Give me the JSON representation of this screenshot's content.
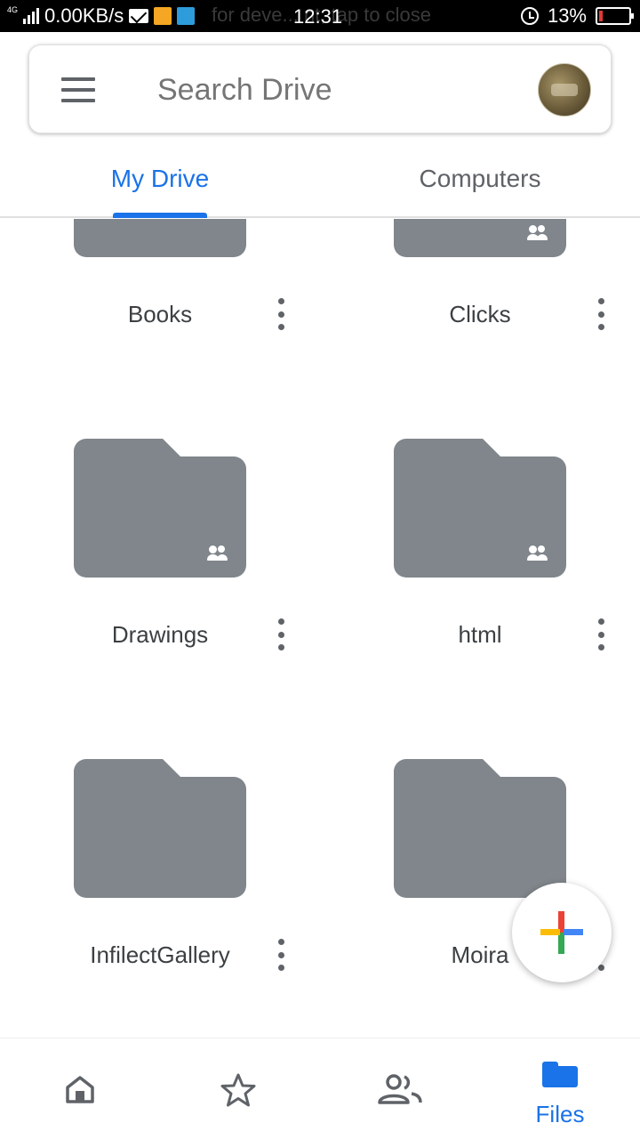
{
  "status_bar": {
    "network": "4G",
    "speed": "0.00KB/s",
    "notification_text": "for deve... nt, tap to close",
    "time": "12:31",
    "battery": "13%",
    "battery_level": 0.13
  },
  "search": {
    "placeholder": "Search Drive",
    "menu_icon": "hamburger-icon",
    "avatar_icon": "avatar"
  },
  "tabs": [
    {
      "label": "My Drive",
      "active": true
    },
    {
      "label": "Computers",
      "active": false
    }
  ],
  "folders": [
    {
      "name": "Books",
      "shared": false
    },
    {
      "name": "Clicks",
      "shared": true
    },
    {
      "name": "Drawings",
      "shared": true
    },
    {
      "name": "html",
      "shared": true
    },
    {
      "name": "InfilectGallery",
      "shared": false
    },
    {
      "name": "Moira",
      "shared": false
    }
  ],
  "fab": {
    "icon": "plus-icon"
  },
  "bottom_nav": [
    {
      "icon": "home-icon",
      "label": ""
    },
    {
      "icon": "star-icon",
      "label": ""
    },
    {
      "icon": "people-icon",
      "label": ""
    },
    {
      "icon": "folder-icon",
      "label": "Files",
      "active": true
    }
  ],
  "colors": {
    "accent": "#1a73e8",
    "folder": "#80868b",
    "text": "#3c4043"
  }
}
